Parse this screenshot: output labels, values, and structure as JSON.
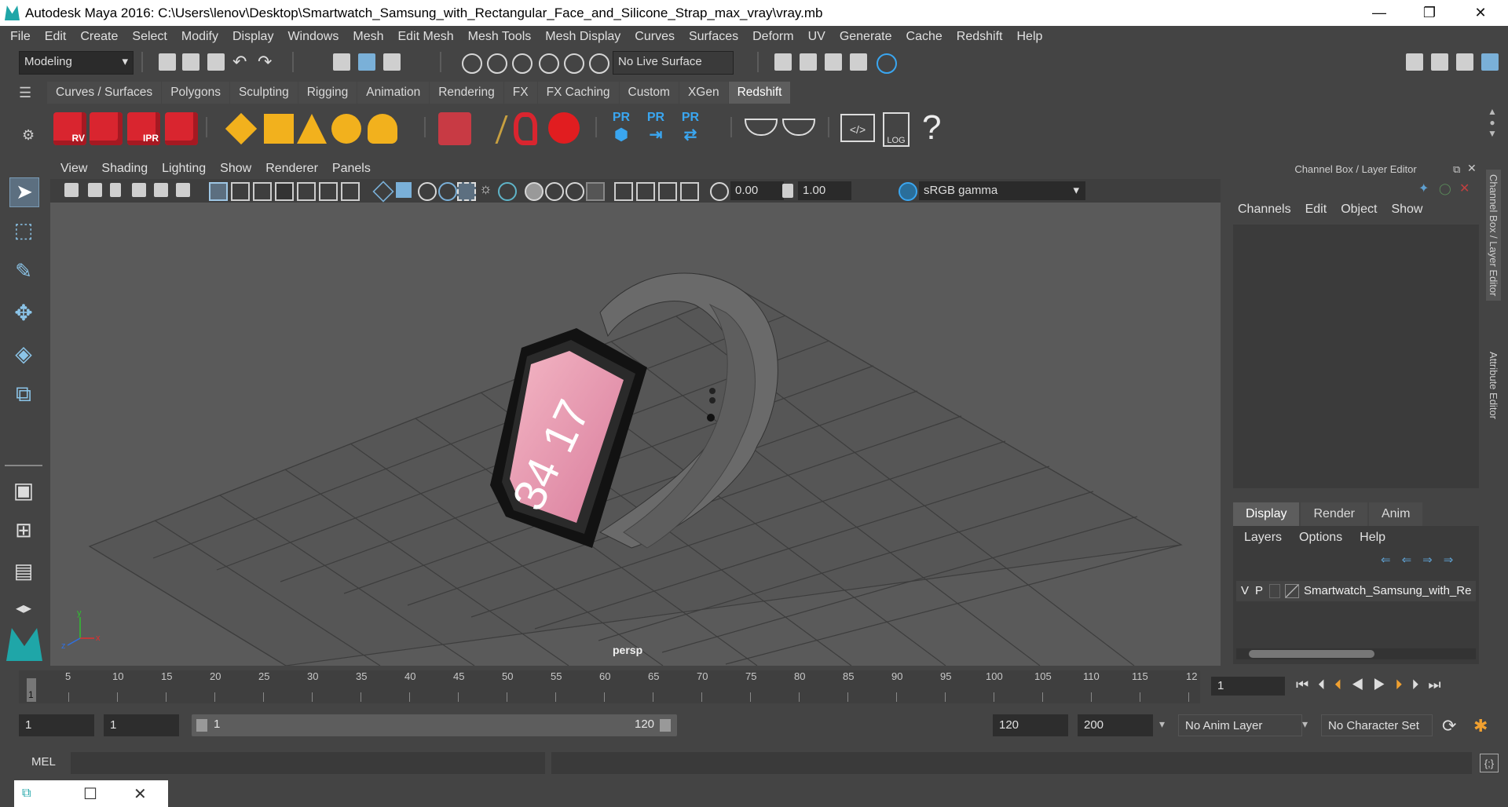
{
  "window": {
    "title": "Autodesk Maya 2016: C:\\Users\\lenov\\Desktop\\Smartwatch_Samsung_with_Rectangular_Face_and_Silicone_Strap_max_vray\\vray.mb",
    "minimize": "—",
    "maximize": "❐",
    "close": "✕"
  },
  "menubar": [
    "File",
    "Edit",
    "Create",
    "Select",
    "Modify",
    "Display",
    "Windows",
    "Mesh",
    "Edit Mesh",
    "Mesh Tools",
    "Mesh Display",
    "Curves",
    "Surfaces",
    "Deform",
    "UV",
    "Generate",
    "Cache",
    "Redshift",
    "Help"
  ],
  "status": {
    "mode": "Modeling",
    "live_surface": "No Live Surface"
  },
  "shelf": {
    "tabs": [
      "Curves / Surfaces",
      "Polygons",
      "Sculpting",
      "Rigging",
      "Animation",
      "Rendering",
      "FX",
      "FX Caching",
      "Custom",
      "XGen",
      "Redshift"
    ],
    "active_tab": "Redshift",
    "cube_labels": [
      "RV",
      "",
      "IPR",
      ""
    ],
    "pr_label": "PR",
    "log_label": "LOG",
    "help": "?"
  },
  "viewport": {
    "menu": [
      "View",
      "Shading",
      "Lighting",
      "Show",
      "Renderer",
      "Panels"
    ],
    "exposure": "0.00",
    "gamma": "1.00",
    "color_space": "sRGB gamma",
    "camera": "persp",
    "watch_time_top": "17",
    "watch_time_bottom": "34",
    "axis_y": "y",
    "axis_x": "x",
    "axis_z": "z"
  },
  "channelbox": {
    "title": "Channel Box / Layer Editor",
    "menu": [
      "Channels",
      "Edit",
      "Object",
      "Show"
    ],
    "layer_tabs": [
      "Display",
      "Render",
      "Anim"
    ],
    "active_layer_tab": "Display",
    "layer_menu": [
      "Layers",
      "Options",
      "Help"
    ],
    "layer": {
      "v": "V",
      "p": "P",
      "name": "Smartwatch_Samsung_with_Re"
    },
    "side_tabs": [
      "Channel Box / Layer Editor",
      "Attribute Editor"
    ]
  },
  "timeline": {
    "ticks": [
      "5",
      "10",
      "15",
      "20",
      "25",
      "30",
      "35",
      "40",
      "45",
      "50",
      "55",
      "60",
      "65",
      "70",
      "75",
      "80",
      "85",
      "90",
      "95",
      "100",
      "105",
      "110",
      "115",
      "12"
    ],
    "current_marker": "1",
    "current_frame": "1"
  },
  "range": {
    "start": "1",
    "playback_start": "1",
    "slider_start": "1",
    "slider_end": "120",
    "playback_end": "120",
    "end": "200",
    "anim_layer": "No Anim Layer",
    "character_set": "No Character Set"
  },
  "cmd": {
    "label": "MEL"
  },
  "colors": {
    "accent": "#5d5d5d",
    "redshift": "#d9252f",
    "pr_blue": "#3aa6f0",
    "yellow": "#f2b11d",
    "maya_teal": "#1fa6a8"
  }
}
